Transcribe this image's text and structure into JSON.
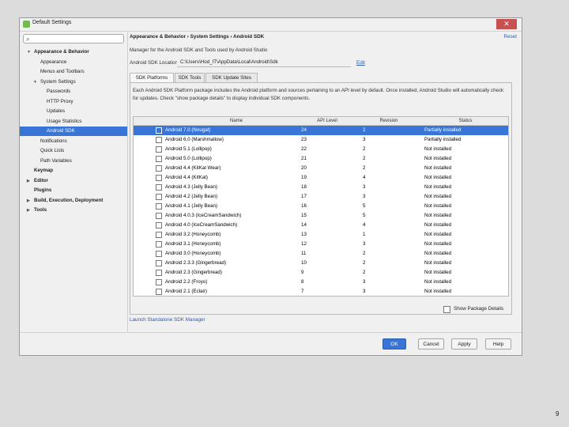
{
  "window": {
    "title": "Default Settings",
    "close_label": "✕"
  },
  "search": {
    "placeholder": ""
  },
  "sidebar": {
    "items": [
      {
        "label": "Appearance & Behavior",
        "level": 0,
        "bold": true,
        "arrow": "▼"
      },
      {
        "label": "Appearance",
        "level": 1
      },
      {
        "label": "Menus and Toolbars",
        "level": 1
      },
      {
        "label": "System Settings",
        "level": 1,
        "arrow": "▼"
      },
      {
        "label": "Passwords",
        "level": 2
      },
      {
        "label": "HTTP Proxy",
        "level": 2
      },
      {
        "label": "Updates",
        "level": 2
      },
      {
        "label": "Usage Statistics",
        "level": 2
      },
      {
        "label": "Android SDK",
        "level": 2,
        "selected": true
      },
      {
        "label": "Notifications",
        "level": 1
      },
      {
        "label": "Quick Lists",
        "level": 1
      },
      {
        "label": "Path Variables",
        "level": 1
      },
      {
        "label": "Keymap",
        "level": 0,
        "bold": true
      },
      {
        "label": "Editor",
        "level": 0,
        "bold": true,
        "arrow": "▶"
      },
      {
        "label": "Plugins",
        "level": 0,
        "bold": true
      },
      {
        "label": "Build, Execution, Deployment",
        "level": 0,
        "bold": true,
        "arrow": "▶"
      },
      {
        "label": "Tools",
        "level": 0,
        "bold": true,
        "arrow": "▶"
      }
    ]
  },
  "main": {
    "breadcrumb": "Appearance & Behavior › System Settings › Android SDK",
    "reset_label": "Reset",
    "description": "Manager for the Android SDK and Tools used by Android Studio",
    "sdk_location_label": "Android SDK Location:",
    "sdk_location_value": "C:\\Users\\Hod_IT\\AppData\\Local\\Android\\Sdk",
    "edit_label": "Edit",
    "tabs": [
      {
        "label": "SDK Platforms",
        "active": true
      },
      {
        "label": "SDK Tools"
      },
      {
        "label": "SDK Update Sites"
      }
    ],
    "panel_description": "Each Android SDK Platform package includes the Android platform and sources pertaining to an API level by default. Once installed, Android Studio will automatically check for updates. Check \"show package details\" to display individual SDK components.",
    "table": {
      "headers": [
        "Name",
        "API Level",
        "Revision",
        "Status"
      ],
      "rows": [
        {
          "name": "Android 7.0 (Nougat)",
          "api": "24",
          "rev": "2",
          "status": "Partially installed",
          "selected": true
        },
        {
          "name": "Android 6.0 (Marshmallow)",
          "api": "23",
          "rev": "3",
          "status": "Partially installed"
        },
        {
          "name": "Android 5.1 (Lollipop)",
          "api": "22",
          "rev": "2",
          "status": "Not installed"
        },
        {
          "name": "Android 5.0 (Lollipop)",
          "api": "21",
          "rev": "2",
          "status": "Not installed"
        },
        {
          "name": "Android 4.4 (KitKat Wear)",
          "api": "20",
          "rev": "2",
          "status": "Not installed"
        },
        {
          "name": "Android 4.4 (KitKat)",
          "api": "19",
          "rev": "4",
          "status": "Not installed"
        },
        {
          "name": "Android 4.3 (Jelly Bean)",
          "api": "18",
          "rev": "3",
          "status": "Not installed"
        },
        {
          "name": "Android 4.2 (Jelly Bean)",
          "api": "17",
          "rev": "3",
          "status": "Not installed"
        },
        {
          "name": "Android 4.1 (Jelly Bean)",
          "api": "16",
          "rev": "5",
          "status": "Not installed"
        },
        {
          "name": "Android 4.0.3 (IceCreamSandwich)",
          "api": "15",
          "rev": "5",
          "status": "Not installed"
        },
        {
          "name": "Android 4.0 (IceCreamSandwich)",
          "api": "14",
          "rev": "4",
          "status": "Not installed"
        },
        {
          "name": "Android 3.2 (Honeycomb)",
          "api": "13",
          "rev": "1",
          "status": "Not installed"
        },
        {
          "name": "Android 3.1 (Honeycomb)",
          "api": "12",
          "rev": "3",
          "status": "Not installed"
        },
        {
          "name": "Android 3.0 (Honeycomb)",
          "api": "11",
          "rev": "2",
          "status": "Not installed"
        },
        {
          "name": "Android 2.3.3 (Gingerbread)",
          "api": "10",
          "rev": "2",
          "status": "Not installed"
        },
        {
          "name": "Android 2.3 (Gingerbread)",
          "api": "9",
          "rev": "2",
          "status": "Not installed"
        },
        {
          "name": "Android 2.2 (Froyo)",
          "api": "8",
          "rev": "3",
          "status": "Not installed"
        },
        {
          "name": "Android 2.1 (Eclair)",
          "api": "7",
          "rev": "3",
          "status": "Not installed"
        }
      ]
    },
    "show_package_details_label": "Show Package Details",
    "launch_label": "Launch Standalone SDK Manager"
  },
  "footer": {
    "ok_label": "OK",
    "cancel_label": "Cancel",
    "apply_label": "Apply",
    "help_label": "Help"
  },
  "page_number": "9",
  "colors": {
    "selection": "#3875d7",
    "link": "#2a5db0"
  }
}
